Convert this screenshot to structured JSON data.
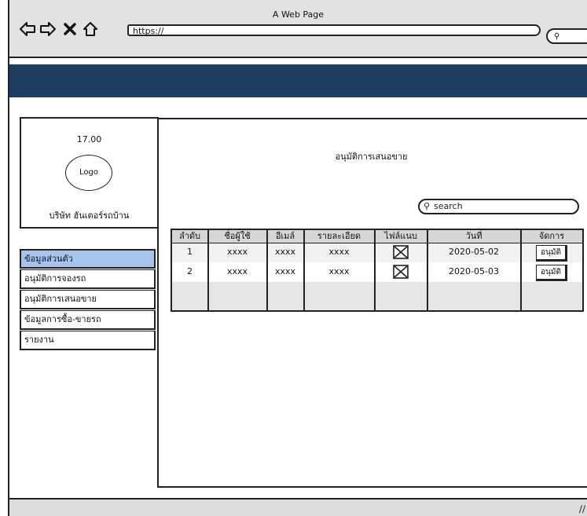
{
  "browser": {
    "title": "A Web Page",
    "url": "https://"
  },
  "card": {
    "time": "17.00",
    "logo": "Logo",
    "company": "บริษัท ฮันเตอร์รถบ้าน"
  },
  "sidebar": {
    "items": [
      {
        "label": "ข้อมูลส่วนตัว",
        "active": true
      },
      {
        "label": "อนุมัติการจองรถ",
        "active": false
      },
      {
        "label": "อนุมัติการเสนอขาย",
        "active": false
      },
      {
        "label": "ข้อมูลการซื้อ-ขายรถ",
        "active": false
      },
      {
        "label": "รายงาน",
        "active": false
      }
    ]
  },
  "main": {
    "title": "อนุมัติการเสนอขาย",
    "search_placeholder": "search",
    "table": {
      "headers": [
        "ลำดับ",
        "ชื่อผู้ใช้",
        "อีเมล์",
        "รายละเอียด",
        "ไฟล์แนบ",
        "วันที่",
        "จัดการ"
      ],
      "rows": [
        {
          "no": "1",
          "user": "xxxx",
          "email": "xxxx",
          "detail": "xxxx",
          "file": "image-placeholder-icon",
          "date": "2020-05-02",
          "action": "อนุมัติ"
        },
        {
          "no": "2",
          "user": "xxxx",
          "email": "xxxx",
          "detail": "xxxx",
          "file": "image-placeholder-icon",
          "date": "2020-05-03",
          "action": "อนุมัติ"
        }
      ]
    }
  },
  "colors": {
    "header_bar": "#1e3d5f",
    "active_menu": "#a6c4ef"
  }
}
